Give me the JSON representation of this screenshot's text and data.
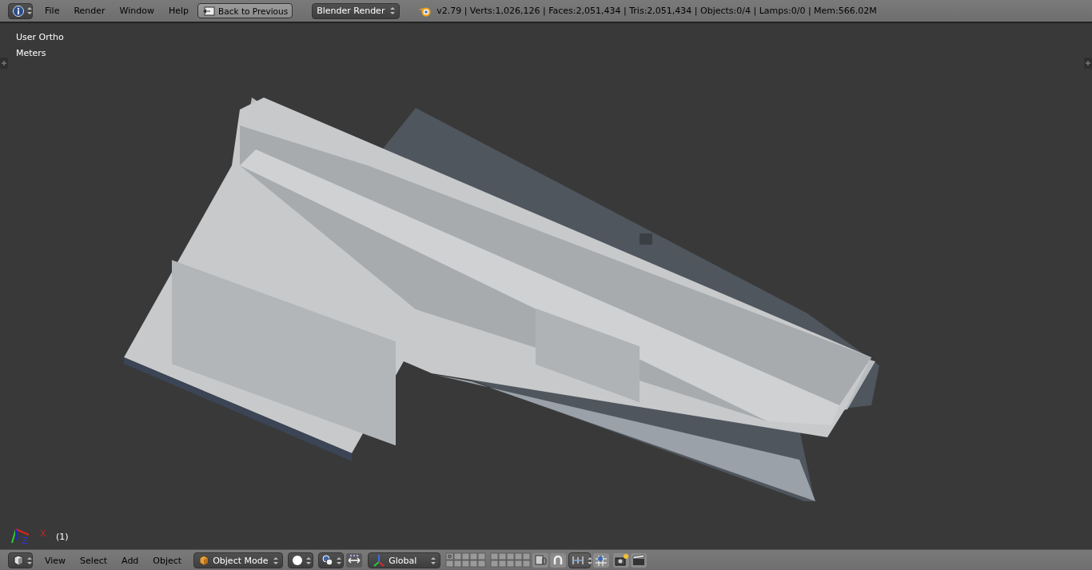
{
  "header": {
    "menus": [
      "File",
      "Render",
      "Window",
      "Help"
    ],
    "back_button": "Back to Previous",
    "engine": "Blender Render",
    "stats": "v2.79 | Verts:1,026,126 | Faces:2,051,434 | Tris:2,051,434 | Objects:0/4 | Lamps:0/0 | Mem:566.02M"
  },
  "viewport": {
    "view_name": "User Ortho",
    "units": "Meters",
    "frame": "(1)",
    "axes": [
      "X",
      "Z"
    ]
  },
  "footer": {
    "menus": [
      "View",
      "Select",
      "Add",
      "Object"
    ],
    "mode": "Object Mode",
    "orientation": "Global"
  }
}
